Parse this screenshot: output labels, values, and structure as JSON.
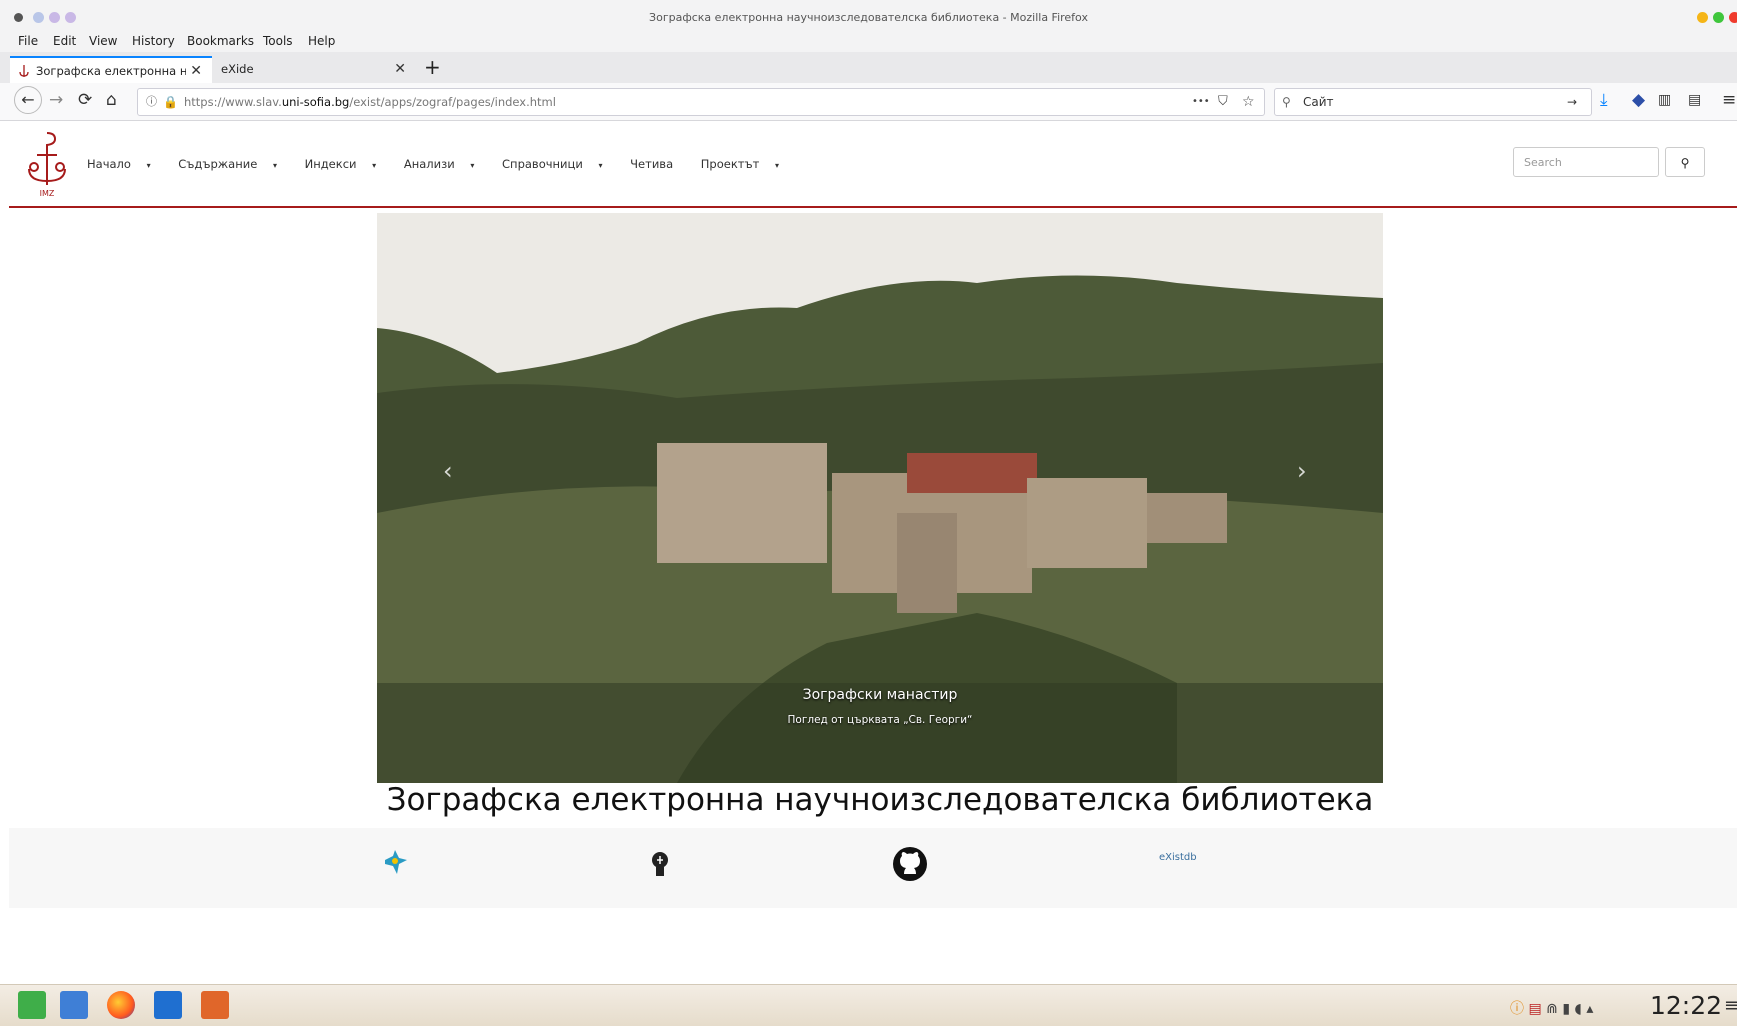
{
  "window": {
    "title": "Зографска електронна научноизследователска библиотека - Mozilla Firefox",
    "menu": [
      "File",
      "Edit",
      "View",
      "History",
      "Bookmarks",
      "Tools",
      "Help"
    ]
  },
  "tabs": [
    {
      "label": "Зографска електронна нау",
      "active": true
    },
    {
      "label": "eXide",
      "active": false
    }
  ],
  "address": {
    "url_prefix": "https://www.slav.",
    "url_domain": "uni-sofia.bg",
    "url_path": "/exist/apps/zograf/pages/index.html",
    "search_placeholder": "Сайт",
    "menu_dots": "•••"
  },
  "site": {
    "logo_text": "IMZ",
    "nav": [
      {
        "label": "Начало",
        "dropdown": true
      },
      {
        "label": "Съдържание",
        "dropdown": true
      },
      {
        "label": "Индекси",
        "dropdown": true
      },
      {
        "label": "Анализи",
        "dropdown": true
      },
      {
        "label": "Справочници",
        "dropdown": true
      },
      {
        "label": "Четива",
        "dropdown": false
      },
      {
        "label": "Проектът",
        "dropdown": true
      }
    ],
    "search_placeholder": "Search",
    "accent": "#a61b1b"
  },
  "carousel": {
    "caption_title": "Зографски манастир",
    "caption_text": "Поглед от църквата „Св. Георги“"
  },
  "page_title": "Зографска електронна научноизследователска библиотека",
  "footer": {
    "icons": [
      "bird-logo-icon",
      "lightbulb-icon",
      "github-icon"
    ],
    "existdb_label": "eXistdb"
  },
  "taskbar": {
    "clock": "12:22",
    "apps": [
      "menu-launcher-icon",
      "file-manager-icon",
      "firefox-icon",
      "writer-icon",
      "impress-icon"
    ]
  }
}
